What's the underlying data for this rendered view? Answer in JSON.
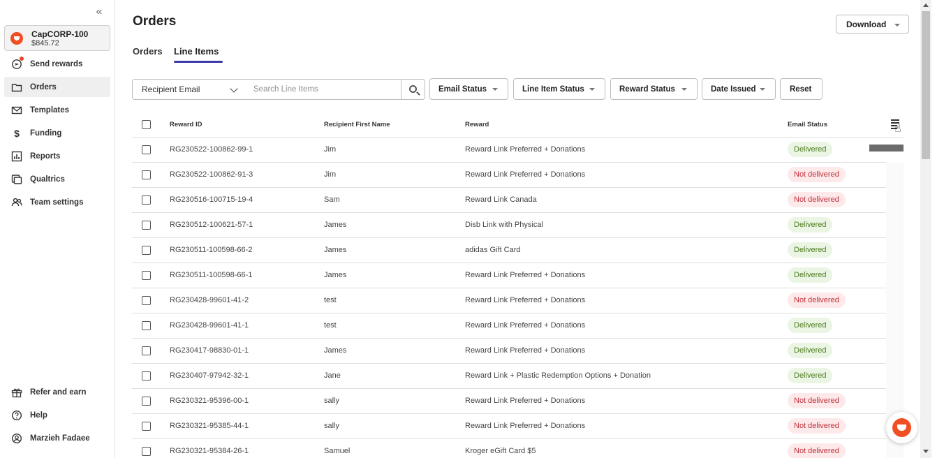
{
  "sidebar": {
    "collapse_icon": "double-chevron-left-icon",
    "account": {
      "name": "CapCORP-100",
      "balance": "$845.72"
    },
    "items": [
      {
        "label": "Send rewards",
        "icon": "send-icon"
      },
      {
        "label": "Orders",
        "icon": "folder-icon",
        "active": true
      },
      {
        "label": "Templates",
        "icon": "mail-icon"
      },
      {
        "label": "Funding",
        "icon": "dollar-icon"
      },
      {
        "label": "Reports",
        "icon": "chart-icon"
      },
      {
        "label": "Qualtrics",
        "icon": "qualtrics-icon"
      },
      {
        "label": "Team settings",
        "icon": "team-icon"
      }
    ],
    "bottom_items": [
      {
        "label": "Refer and earn",
        "icon": "gift-icon"
      },
      {
        "label": "Help",
        "icon": "help-icon"
      },
      {
        "label": "Marzieh Fadaee",
        "icon": "user-icon"
      }
    ]
  },
  "header": {
    "title": "Orders",
    "download_label": "Download",
    "tabs": [
      {
        "label": "Orders",
        "active": false
      },
      {
        "label": "Line Items",
        "active": true
      }
    ]
  },
  "filters": {
    "field_select": "Recipient Email",
    "search_placeholder": "Search Line Items",
    "buttons": [
      "Email Status",
      "Line Item Status",
      "Reward Status",
      "Date Issued"
    ],
    "reset_label": "Reset"
  },
  "table": {
    "columns": [
      "Reward ID",
      "Recipient First Name",
      "Reward",
      "Email Status"
    ],
    "rows": [
      {
        "id": "RG230522-100862-99-1",
        "name": "Jim",
        "reward": "Reward Link Preferred + Donations",
        "status": "Delivered"
      },
      {
        "id": "RG230522-100862-91-3",
        "name": "Jim",
        "reward": "Reward Link Preferred + Donations",
        "status": "Not delivered"
      },
      {
        "id": "RG230516-100715-19-4",
        "name": "Sam",
        "reward": "Reward Link Canada",
        "status": "Not delivered"
      },
      {
        "id": "RG230512-100621-57-1",
        "name": "James",
        "reward": "Disb Link with Physical",
        "status": "Delivered"
      },
      {
        "id": "RG230511-100598-66-2",
        "name": "James",
        "reward": "adidas Gift Card",
        "status": "Delivered"
      },
      {
        "id": "RG230511-100598-66-1",
        "name": "James",
        "reward": "Reward Link Preferred + Donations",
        "status": "Delivered"
      },
      {
        "id": "RG230428-99601-41-2",
        "name": "test",
        "reward": "Reward Link Preferred + Donations",
        "status": "Not delivered"
      },
      {
        "id": "RG230428-99601-41-1",
        "name": "test",
        "reward": "Reward Link Preferred + Donations",
        "status": "Delivered"
      },
      {
        "id": "RG230417-98830-01-1",
        "name": "James",
        "reward": "Reward Link Preferred + Donations",
        "status": "Delivered"
      },
      {
        "id": "RG230407-97942-32-1",
        "name": "Jane",
        "reward": "Reward Link + Plastic Redemption Options + Donation",
        "status": "Delivered"
      },
      {
        "id": "RG230321-95396-00-1",
        "name": "sally",
        "reward": "Reward Link Preferred + Donations",
        "status": "Not delivered"
      },
      {
        "id": "RG230321-95385-44-1",
        "name": "sally",
        "reward": "Reward Link Preferred + Donations",
        "status": "Not delivered"
      },
      {
        "id": "RG230321-95384-26-1",
        "name": "Samuel",
        "reward": "Kroger eGift Card $5",
        "status": "Not delivered"
      }
    ]
  },
  "colors": {
    "accent": "#3e3aa8",
    "brand": "#f04e23",
    "delivered_bg": "#eaf5e3",
    "delivered_text": "#4d7c20",
    "not_delivered_bg": "#fde9ea",
    "not_delivered_text": "#c0313b"
  }
}
